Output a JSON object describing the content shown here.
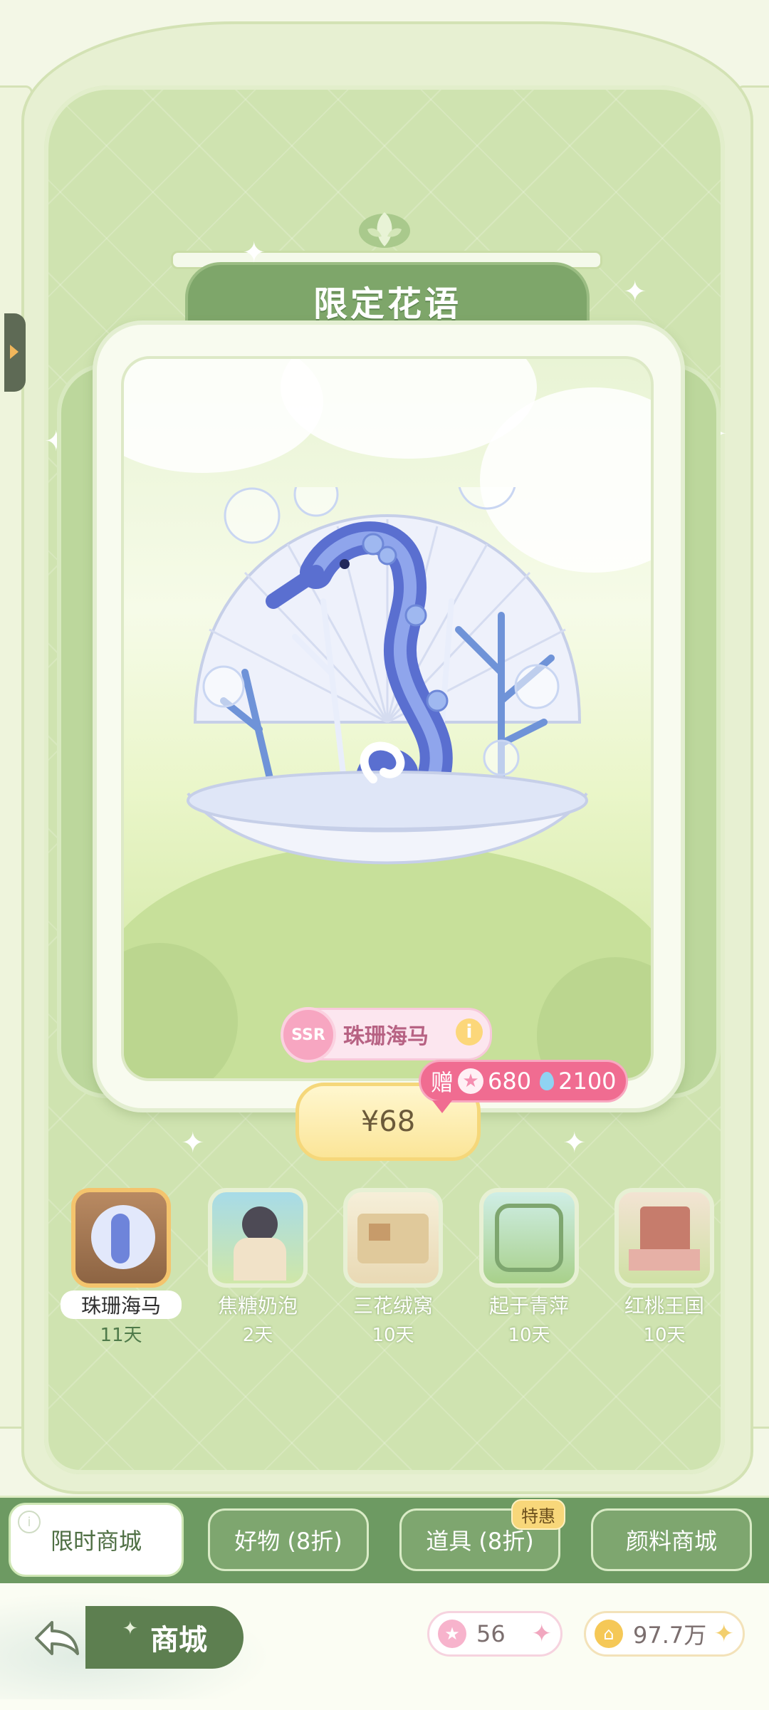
{
  "banner": {
    "title": "限定花语"
  },
  "featured": {
    "rarity": "SSR",
    "name": "珠珊海马",
    "price": "¥68",
    "gift": {
      "label": "赠",
      "stars": "680",
      "drops": "2100"
    }
  },
  "thumbnails": [
    {
      "name": "珠珊海马",
      "days": "11天",
      "selected": true
    },
    {
      "name": "焦糖奶泡",
      "days": "2天",
      "selected": false
    },
    {
      "name": "三花绒窝",
      "days": "10天",
      "selected": false
    },
    {
      "name": "起于青萍",
      "days": "10天",
      "selected": false
    },
    {
      "name": "红桃王国",
      "days": "10天",
      "selected": false
    }
  ],
  "tabs": [
    {
      "label": "限时商城",
      "active": true
    },
    {
      "label": "好物 (8折)",
      "active": false
    },
    {
      "label": "道具 (8折)",
      "active": false,
      "badge": "特惠"
    },
    {
      "label": "颜料商城",
      "active": false
    }
  ],
  "footer": {
    "title": "商城",
    "star_currency": "56",
    "coin_currency": "97.7万"
  },
  "colors": {
    "accent_green": "#6d9a62",
    "pink": "#f06c91",
    "gold": "#f5d77a"
  },
  "icons": [
    "back-arrow-icon",
    "star-icon",
    "drop-icon",
    "coin-icon",
    "plus-icon",
    "info-icon",
    "sparkle-icon",
    "leaf-icon"
  ]
}
